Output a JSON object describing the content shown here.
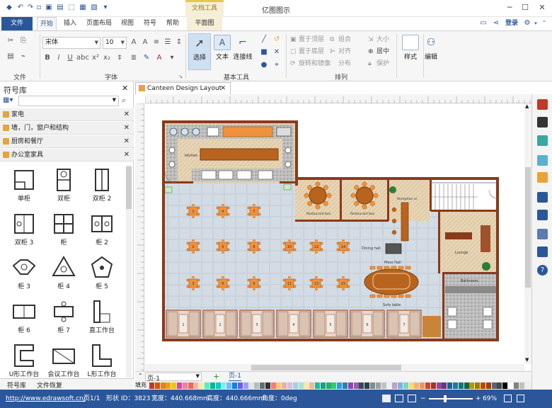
{
  "app": {
    "title": "亿图图示",
    "context_group": "文档工具"
  },
  "menu": {
    "file": "文件",
    "tabs": [
      {
        "label": "开始"
      },
      {
        "label": "插入"
      },
      {
        "label": "页面布局"
      },
      {
        "label": "视图"
      },
      {
        "label": "符号"
      },
      {
        "label": "帮助"
      },
      {
        "label": "平面图"
      }
    ],
    "login": "登录"
  },
  "ribbon": {
    "font_name": "宋体",
    "font_size": "10",
    "groups": {
      "file": "文件",
      "font": "字体",
      "basic_tools": "基本工具",
      "arrange": "排列"
    },
    "bold": "B",
    "italic": "I",
    "underline": "U",
    "big_buttons": {
      "select": "选择",
      "text": "文本",
      "connector": "连接线",
      "style": "样式",
      "edit": "编辑"
    },
    "arrange_items": {
      "bring_front": "置于顶层",
      "send_back": "置于底层",
      "rotate_mirror": "旋转和镜像",
      "group": "组合",
      "align": "对齐",
      "distribute": "分布",
      "size": "大小",
      "center": "居中",
      "protect": "保护"
    }
  },
  "library": {
    "title": "符号库",
    "categories": [
      {
        "label": "家电"
      },
      {
        "label": "墙，门，窗户和结构"
      },
      {
        "label": "厨房和餐厅"
      },
      {
        "label": "办公室家具"
      }
    ],
    "shapes": [
      {
        "label": "单柜"
      },
      {
        "label": "双柜"
      },
      {
        "label": "双柜 2"
      },
      {
        "label": "双柜 3"
      },
      {
        "label": "柜"
      },
      {
        "label": "柜 2"
      },
      {
        "label": "柜 3"
      },
      {
        "label": "柜 4"
      },
      {
        "label": "柜 5"
      },
      {
        "label": "柜 6"
      },
      {
        "label": "柜 7"
      },
      {
        "label": "直工作台"
      },
      {
        "label": "U形工作台"
      },
      {
        "label": "会议工作台"
      },
      {
        "label": "L形工作台"
      }
    ],
    "bottom_tabs": {
      "library": "符号库",
      "recovery": "文件恢复"
    }
  },
  "document": {
    "tab_title": "Canteen Design Layout"
  },
  "plan": {
    "room_labels": {
      "kitchen": "kitchen",
      "restaurant1": "Restaurant box",
      "restaurant2": "Restaurant box",
      "reception": "Reception al",
      "dining": "Dining hall",
      "mess": "Mess Hall",
      "sofa": "Sofa table",
      "lounge": "Lounge",
      "bathroom": "Bathroom"
    },
    "table_numbers_left": [
      "1",
      "4",
      "7",
      "2",
      "5",
      "8",
      "3",
      "6",
      "9"
    ],
    "table_numbers_right": [
      "10",
      "12",
      "14",
      "11",
      "13",
      "15"
    ],
    "booth_numbers": [
      "1",
      "2",
      "3",
      "4",
      "5",
      "6",
      "7"
    ]
  },
  "pages": {
    "current": "页-1",
    "tab": "页-1",
    "add": "+"
  },
  "colorbar": {
    "label": "填充"
  },
  "status": {
    "url": "http://www.edrawsoft.cn/",
    "page": "页1/1",
    "shape_id": "形状 ID：3823",
    "width": "宽度：440.668mm",
    "height": "高度：440.666mm",
    "angle": "角度：0deg",
    "zoom": "69%"
  },
  "colors": {
    "accent": "#2b579a",
    "wall": "#8b3a1a",
    "chair": "#f0913c",
    "table": "#b8641e"
  }
}
